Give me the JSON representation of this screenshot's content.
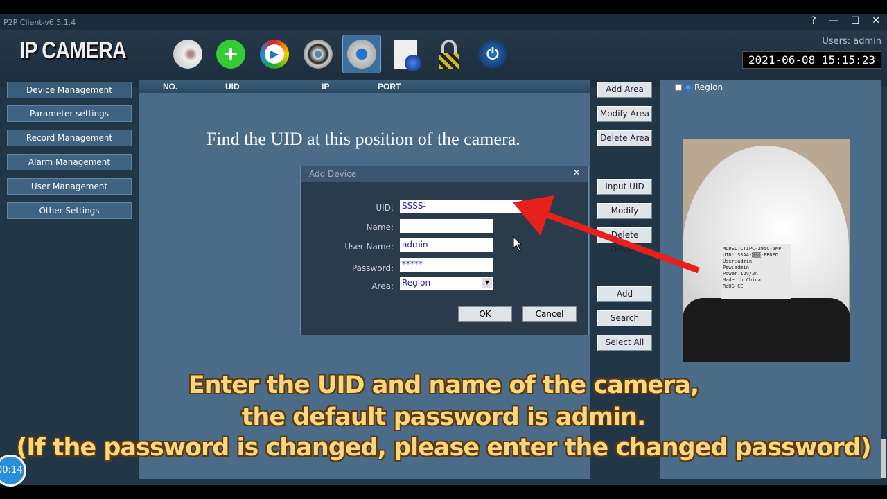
{
  "window": {
    "title": "P2P Client-v6.5.1.4",
    "controls": [
      "?",
      "—",
      "☐",
      "✕"
    ]
  },
  "header": {
    "logo": "IP CAMERA",
    "users": "Users: admin",
    "clock": "2021-06-08 15:15:23",
    "tools": [
      "camera-icon",
      "add-icon",
      "playback-icon",
      "ptz-icon",
      "settings-icon",
      "log-icon",
      "lock-icon",
      "power-icon"
    ]
  },
  "sidebar": {
    "items": [
      "Device Management",
      "Parameter settings",
      "Record Management",
      "Alarm Management",
      "User Management",
      "Other Settings"
    ]
  },
  "table": {
    "columns": [
      "NO.",
      "UID",
      "IP",
      "PORT"
    ]
  },
  "hint": "Find the UID at this position of the camera.",
  "buttons": {
    "add_area": "Add Area",
    "modify_area": "Modify Area",
    "delete_area": "Delete Area",
    "input_uid": "Input UID",
    "modify_device": "Modify Device",
    "delete_device": "Delete Device",
    "add": "Add",
    "search": "Search",
    "select_all": "Select All"
  },
  "region": {
    "label": "Region"
  },
  "dialog": {
    "title": "Add Device",
    "uid_label": "UID:",
    "uid": "SSSS-",
    "name_label": "Name:",
    "name": "",
    "user_label": "User Name:",
    "user": "admin",
    "password_label": "Password:",
    "password": "*****",
    "area_label": "Area:",
    "area": "Region",
    "ok": "OK",
    "cancel": "Cancel"
  },
  "photo_label": {
    "l1": "MODEL:CTIPC-295C-5MP",
    "l2": "UID: SSAA-▒▒▒-FBDFD",
    "l3": "User:admin",
    "l4": "Psw:admin",
    "l5": "Power:12V/2A",
    "l6": "Made in China",
    "l7": "RoHS CE"
  },
  "subtitles": [
    "Enter the UID and name of the camera,",
    "the default password is admin.",
    "(If the password is changed, please enter the changed password)"
  ],
  "video": {
    "time": "00:14"
  },
  "colors": {
    "arrow": "#e8201c",
    "subtitle": "#ffd77a"
  }
}
